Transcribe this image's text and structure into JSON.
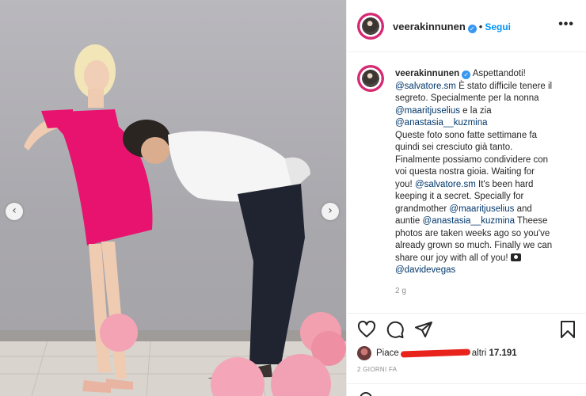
{
  "post": {
    "username": "veerakinnunen",
    "verified": true,
    "separator": "•",
    "follow_label": "Segui",
    "more_label": "•••",
    "caption": {
      "lines": [
        [
          {
            "t": "text",
            "v": "Aspettandoti!"
          }
        ],
        [
          {
            "t": "mention",
            "v": "@salvatore.sm"
          },
          {
            "t": "text",
            "v": " È stato difficile tenere il"
          }
        ],
        [
          {
            "t": "text",
            "v": "segreto. Specialmente per la nonna"
          }
        ],
        [
          {
            "t": "mention",
            "v": "@maaritjuselius"
          },
          {
            "t": "text",
            "v": " e la zia"
          }
        ],
        [
          {
            "t": "mention",
            "v": "@anastasia__kuzmina"
          }
        ],
        [
          {
            "t": "text",
            "v": "Queste foto sono fatte settimane fa"
          }
        ],
        [
          {
            "t": "text",
            "v": "quindi sei cresciuto già tanto."
          }
        ],
        [
          {
            "t": "text",
            "v": "Finalmente possiamo condividere con"
          }
        ],
        [
          {
            "t": "text",
            "v": "voi questa nostra gioia. Waiting for"
          }
        ],
        [
          {
            "t": "text",
            "v": "you! "
          },
          {
            "t": "mention",
            "v": "@salvatore.sm"
          },
          {
            "t": "text",
            "v": " It's been hard"
          }
        ],
        [
          {
            "t": "text",
            "v": "keeping it a secret. Specially for"
          }
        ],
        [
          {
            "t": "text",
            "v": "grandmother "
          },
          {
            "t": "mention",
            "v": "@maaritjuselius"
          },
          {
            "t": "text",
            "v": " and"
          }
        ],
        [
          {
            "t": "text",
            "v": "auntie "
          },
          {
            "t": "mention",
            "v": "@anastasia__kuzmina"
          },
          {
            "t": "text",
            "v": " Theese"
          }
        ],
        [
          {
            "t": "text",
            "v": "photos are taken weeks ago so you've"
          }
        ],
        [
          {
            "t": "text",
            "v": "already grown so much. Finally we can"
          }
        ],
        [
          {
            "t": "text",
            "v": "share our joy with all of you! "
          },
          {
            "t": "icon",
            "v": "camera-icon"
          }
        ],
        [
          {
            "t": "mention",
            "v": "@davidevegas"
          }
        ]
      ]
    },
    "age": "2 g",
    "likes": {
      "prefix": "Piace",
      "suffix": "altri",
      "count": "17.191"
    },
    "time_ago": "2 GIORNI FA"
  },
  "photo": {
    "left_arrow_icon": "chevron-left-icon",
    "right_arrow_icon": "chevron-right-icon",
    "arrow_left_glyph": "‹",
    "arrow_right_glyph": "›",
    "colors": {
      "dress": "#e8136e",
      "balloon": "#f4a3b4",
      "shirt": "#f5f5f5",
      "trousers": "#1f2430",
      "wall": "#b3b2b7"
    }
  },
  "actions": {
    "icons": [
      "heart-icon",
      "comment-icon",
      "share-icon",
      "bookmark-icon"
    ]
  },
  "colors": {
    "link": "#00376b",
    "follow": "#0095f6",
    "redaction": "#e8231c",
    "verified": "#3897f0"
  }
}
